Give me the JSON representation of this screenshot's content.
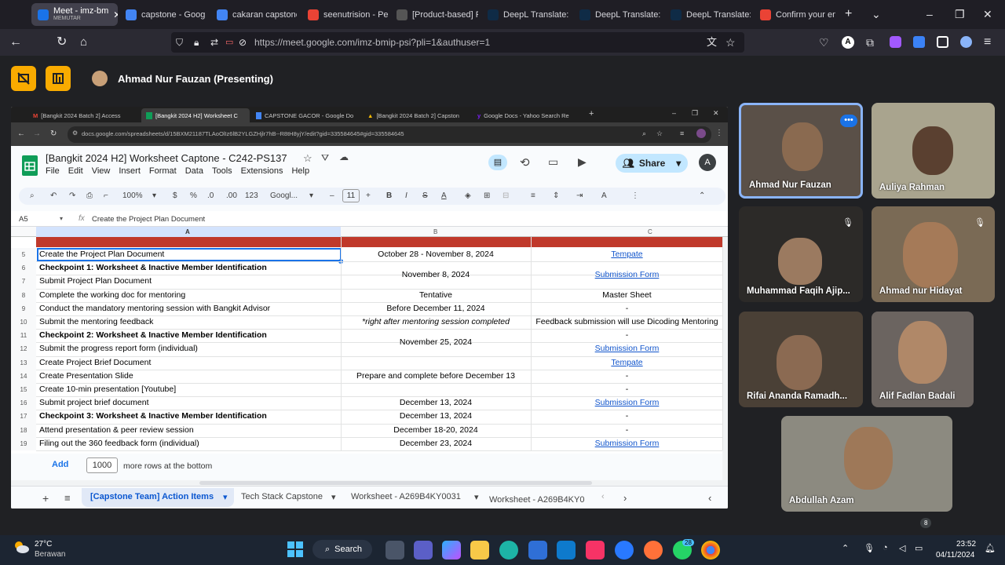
{
  "browser": {
    "tabs": [
      {
        "label": "Meet - imz-bm",
        "sublabel": "MEMUTAR",
        "color": "#1a73e8"
      },
      {
        "label": "capstone - Googl",
        "color": "#4285f4"
      },
      {
        "label": "cakaran capstone",
        "color": "#4285f4"
      },
      {
        "label": "seenutrision - Pe",
        "color": "#ea4335"
      },
      {
        "label": "[Product-based] Proj",
        "color": "#555"
      },
      {
        "label": "DeepL Translate:",
        "color": "#0f2b46"
      },
      {
        "label": "DeepL Translate:",
        "color": "#0f2b46"
      },
      {
        "label": "DeepL Translate:",
        "color": "#0f2b46"
      },
      {
        "label": "Confirm your em",
        "color": "#ea4335"
      }
    ],
    "url": "https://meet.google.com/imz-bmip-psi?pli=1&authuser=1"
  },
  "meet": {
    "presenter": "Ahmad Nur Fauzan (Presenting)"
  },
  "inner": {
    "tabs": [
      "[Bangkit 2024 Batch 2] Access",
      "[Bangkit 2024 H2] Worksheet C",
      "CAPSTONE GACOR - Google Do",
      "[Bangkit 2024 Batch 2] Capston",
      "Google Docs - Yahoo Search Re"
    ],
    "url": "docs.google.com/spreadsheets/d/15BXM21187TLAoOlIz6lB2YLGZHjlr7hB--R8tH8yjY/edit?gid=335584645#gid=335584645",
    "doc_title": "[Bangkit 2024 H2] Worksheet Captone - C242-PS137",
    "menus": [
      "File",
      "Edit",
      "View",
      "Insert",
      "Format",
      "Data",
      "Tools",
      "Extensions",
      "Help"
    ],
    "share_label": "Share",
    "avatar": "A",
    "toolbar": {
      "zoom": "100%",
      "currency": "$",
      "percent": "%",
      "dec_minus": ".0",
      "dec_plus": ".00",
      "num": "123",
      "font": "Googl...",
      "size": "11"
    },
    "cell_ref": "A5",
    "formula": "Create the Project Plan Document",
    "col_headers": [
      "A",
      "B",
      "C"
    ],
    "rows": [
      {
        "n": "5",
        "a": "Create the Project Plan Document",
        "b": "October 28 - November 8, 2024",
        "c": "Tempate",
        "bold": false,
        "clink": true
      },
      {
        "n": "6",
        "a": "Checkpoint 1: Worksheet & Inactive Member Identification",
        "b": "",
        "c": "",
        "bold": true,
        "clink": false
      },
      {
        "n": "7",
        "a": "Submit Project Plan Document",
        "b": "",
        "c": "",
        "bold": false,
        "clink": false
      },
      {
        "n": "8",
        "a": "Complete the working doc for mentoring",
        "b": "Tentative",
        "c": "Master Sheet",
        "bold": false,
        "clink": false
      },
      {
        "n": "9",
        "a": "Conduct the mandatory mentoring session with Bangkit Advisor",
        "b": "Before December 11, 2024",
        "c": "-",
        "bold": false,
        "clink": false
      },
      {
        "n": "10",
        "a": "Submit the mentoring feedback",
        "b": "*right after mentoring session completed",
        "c": "Feedback submission will use Dicoding Mentoring",
        "bold": false,
        "clink": false,
        "bitalic": true
      },
      {
        "n": "11",
        "a": "Checkpoint 2: Worksheet & Inactive Member Identification",
        "b": "",
        "c": "-",
        "bold": true,
        "clink": false
      },
      {
        "n": "12",
        "a": "Submit the progress report form (individual)",
        "b": "",
        "c": "Submission Form",
        "bold": false,
        "clink": true
      },
      {
        "n": "13",
        "a": "Create Project Brief Document",
        "b": "",
        "c": "Tempate",
        "bold": false,
        "clink": true
      },
      {
        "n": "14",
        "a": "Create Presentation Slide",
        "b": "",
        "c": "-",
        "bold": false,
        "clink": false
      },
      {
        "n": "15",
        "a": "Create 10-min presentation [Youtube]",
        "b": "",
        "c": "-",
        "bold": false,
        "clink": false
      },
      {
        "n": "16",
        "a": "Submit project brief document",
        "b": "December 13, 2024",
        "c": "Submission Form",
        "bold": false,
        "clink": true
      },
      {
        "n": "17",
        "a": "Checkpoint 3: Worksheet & Inactive Member Identification",
        "b": "December 13, 2024",
        "c": "-",
        "bold": true,
        "clink": false
      },
      {
        "n": "18",
        "a": "Attend presentation & peer review session",
        "b": "December 18-20, 2024",
        "c": "-",
        "bold": false,
        "clink": false
      },
      {
        "n": "19",
        "a": "Filing out the 360 feedback form (individual)",
        "b": "December 23, 2024",
        "c": "Submission Form",
        "bold": false,
        "clink": true
      }
    ],
    "merged": [
      {
        "text": "November 8, 2024",
        "r0": 1,
        "r1": 2
      },
      {
        "text": "November 25, 2024",
        "r0": 6,
        "r1": 7
      },
      {
        "text": "Prepare and complete before December 13",
        "r0": 8,
        "r1": 10
      }
    ],
    "merged_c": {
      "text": "Submission Form",
      "r0": 1,
      "r1": 2
    },
    "add_label": "Add",
    "add_rows": "1000",
    "add_suffix": "more rows at the bottom",
    "sheet_tabs": [
      "[Capstone Team] Action Items",
      "Tech Stack Capstone",
      "Worksheet - A269B4KY0031",
      "Worksheet - A269B4KY0"
    ]
  },
  "participants": [
    "Ahmad Nur Fauzan",
    "Auliya Rahman",
    "Muhammad Faqih Ajip...",
    "Ahmad nur Hidayat",
    "Rifai Ananda Ramadh...",
    "Alif Fadlan Badali",
    "Abdullah Azam"
  ],
  "taskbar": {
    "temp": "27°C",
    "weather": "Berawan",
    "search": "Search",
    "time": "23:52",
    "date": "04/11/2024",
    "badge1": "28",
    "badge2": "8"
  }
}
